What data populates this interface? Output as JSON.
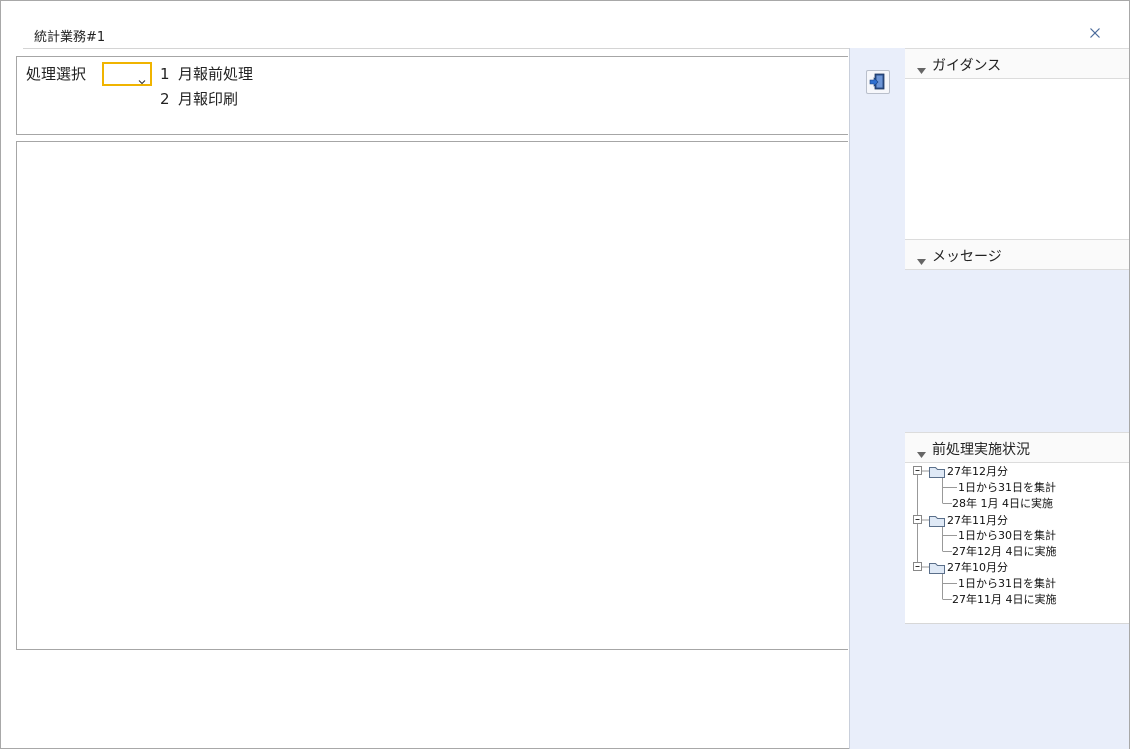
{
  "window": {
    "title": "統計業務#1",
    "close_icon": "close-icon"
  },
  "process": {
    "label": "処理選択",
    "selected_value": "",
    "options": [
      {
        "num": "1",
        "label": "月報前処理"
      },
      {
        "num": "2",
        "label": "月報印刷"
      }
    ]
  },
  "toolbar": {
    "exit_icon": "exit-door-icon"
  },
  "panels": {
    "guidance": {
      "title": "ガイダンス"
    },
    "message": {
      "title": "メッセージ"
    },
    "status": {
      "title": "前処理実施状況",
      "tree": [
        {
          "label": "27年12月分",
          "detail1": "1日から31日を集計",
          "detail2": "28年 1月 4日に実施"
        },
        {
          "label": "27年11月分",
          "detail1": "1日から30日を集計",
          "detail2": "27年12月 4日に実施"
        },
        {
          "label": "27年10月分",
          "detail1": "1日から31日を集計",
          "detail2": "27年11月 4日に実施"
        }
      ]
    }
  },
  "colors": {
    "accent_select_border": "#f0b400",
    "side_background": "#e9eefa"
  }
}
